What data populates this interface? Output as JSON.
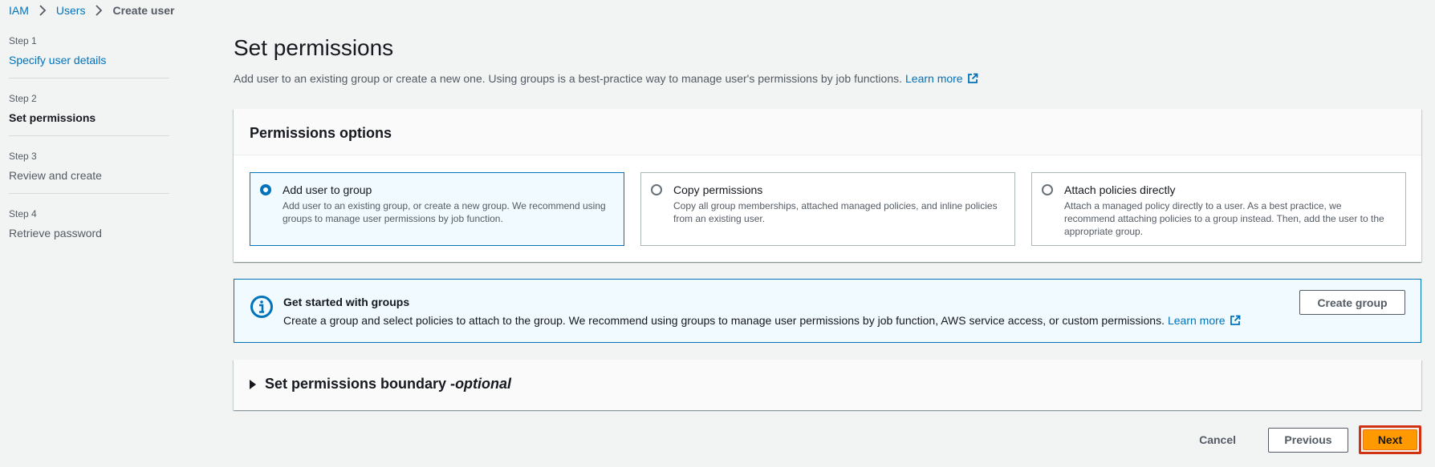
{
  "breadcrumb": {
    "items": [
      "IAM",
      "Users"
    ],
    "current": "Create user"
  },
  "steps": [
    {
      "num": "Step 1",
      "label": "Specify user details"
    },
    {
      "num": "Step 2",
      "label": "Set permissions"
    },
    {
      "num": "Step 3",
      "label": "Review and create"
    },
    {
      "num": "Step 4",
      "label": "Retrieve password"
    }
  ],
  "page": {
    "title": "Set permissions",
    "description": "Add user to an existing group or create a new one. Using groups is a best-practice way to manage user's permissions by job functions.",
    "learn_more": "Learn more"
  },
  "permissions_options": {
    "title": "Permissions options",
    "tiles": [
      {
        "title": "Add user to group",
        "desc": "Add user to an existing group, or create a new group. We recommend using groups to manage user permissions by job function.",
        "selected": true
      },
      {
        "title": "Copy permissions",
        "desc": "Copy all group memberships, attached managed policies, and inline policies from an existing user.",
        "selected": false
      },
      {
        "title": "Attach policies directly",
        "desc": "Attach a managed policy directly to a user. As a best practice, we recommend attaching policies to a group instead. Then, add the user to the appropriate group.",
        "selected": false
      }
    ]
  },
  "info_box": {
    "icon": "info-icon",
    "title": "Get started with groups",
    "text": "Create a group and select policies to attach to the group. We recommend using groups to manage user permissions by job function, AWS service access, or custom permissions.",
    "learn_more": "Learn more",
    "button": "Create group"
  },
  "boundary": {
    "title": "Set permissions boundary - ",
    "optional": "optional"
  },
  "footer": {
    "cancel": "Cancel",
    "previous": "Previous",
    "next": "Next"
  },
  "colors": {
    "link": "#0073bb",
    "primary": "#ff9900",
    "highlight_outline": "#d13212"
  }
}
